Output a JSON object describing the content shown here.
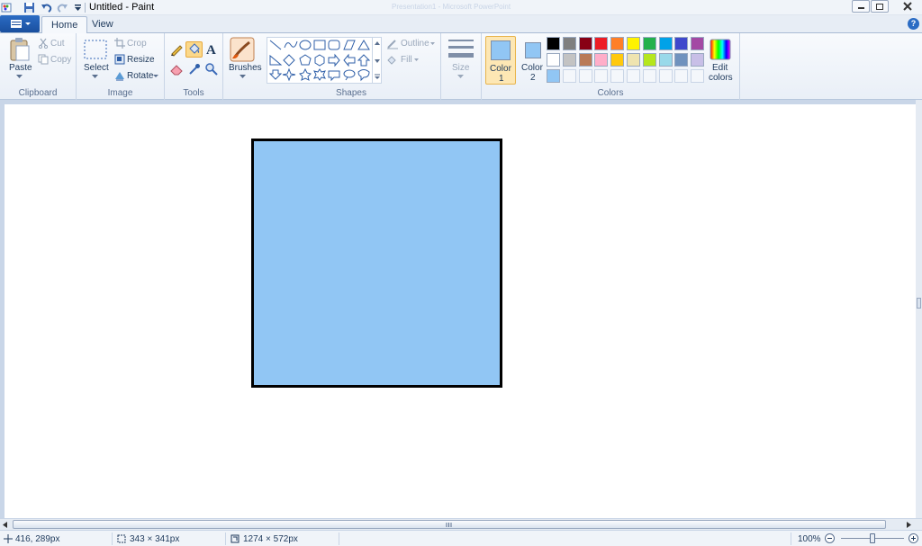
{
  "window": {
    "title": "Untitled - Paint",
    "ghost_title": "Presentation1 - Microsoft PowerPoint"
  },
  "tabs": [
    {
      "label": "Home",
      "active": true
    },
    {
      "label": "View",
      "active": false
    }
  ],
  "clipboard": {
    "paste": "Paste",
    "cut": "Cut",
    "copy": "Copy",
    "label": "Clipboard"
  },
  "image": {
    "select": "Select",
    "crop": "Crop",
    "resize": "Resize",
    "rotate": "Rotate",
    "label": "Image"
  },
  "tools": {
    "label": "Tools"
  },
  "brushes": {
    "label": "Brushes"
  },
  "shapes": {
    "outline": "Outline",
    "fill": "Fill",
    "label": "Shapes"
  },
  "size": {
    "label": "Size"
  },
  "colors": {
    "color1_label": "Color",
    "color1_num": "1",
    "color2_label": "Color",
    "color2_num": "2",
    "edit_colors_1": "Edit",
    "edit_colors_2": "colors",
    "label": "Colors",
    "color1": "#91c6f4",
    "color2": "#91c6f4",
    "palette_row1": [
      "#000000",
      "#7f7f7f",
      "#880015",
      "#ed1c24",
      "#ff7f27",
      "#fff200",
      "#22b14c",
      "#00a2e8",
      "#3f48cc",
      "#a349a4"
    ],
    "palette_row2": [
      "#ffffff",
      "#c3c3c3",
      "#b97a57",
      "#ffaec9",
      "#ffc90e",
      "#efe4b0",
      "#b5e61d",
      "#99d9ea",
      "#7092be",
      "#c8bfe7"
    ],
    "palette_row3": [
      "#91c6f4",
      "",
      "",
      "",
      "",
      "",
      "",
      "",
      "",
      ""
    ]
  },
  "canvas": {
    "shape_fill": "#91c6f4",
    "shape_outline": "#000000"
  },
  "status": {
    "cursor_pos": "416, 289px",
    "selection_size": "343 × 341px",
    "image_size": "1274 × 572px",
    "zoom": "100%"
  }
}
